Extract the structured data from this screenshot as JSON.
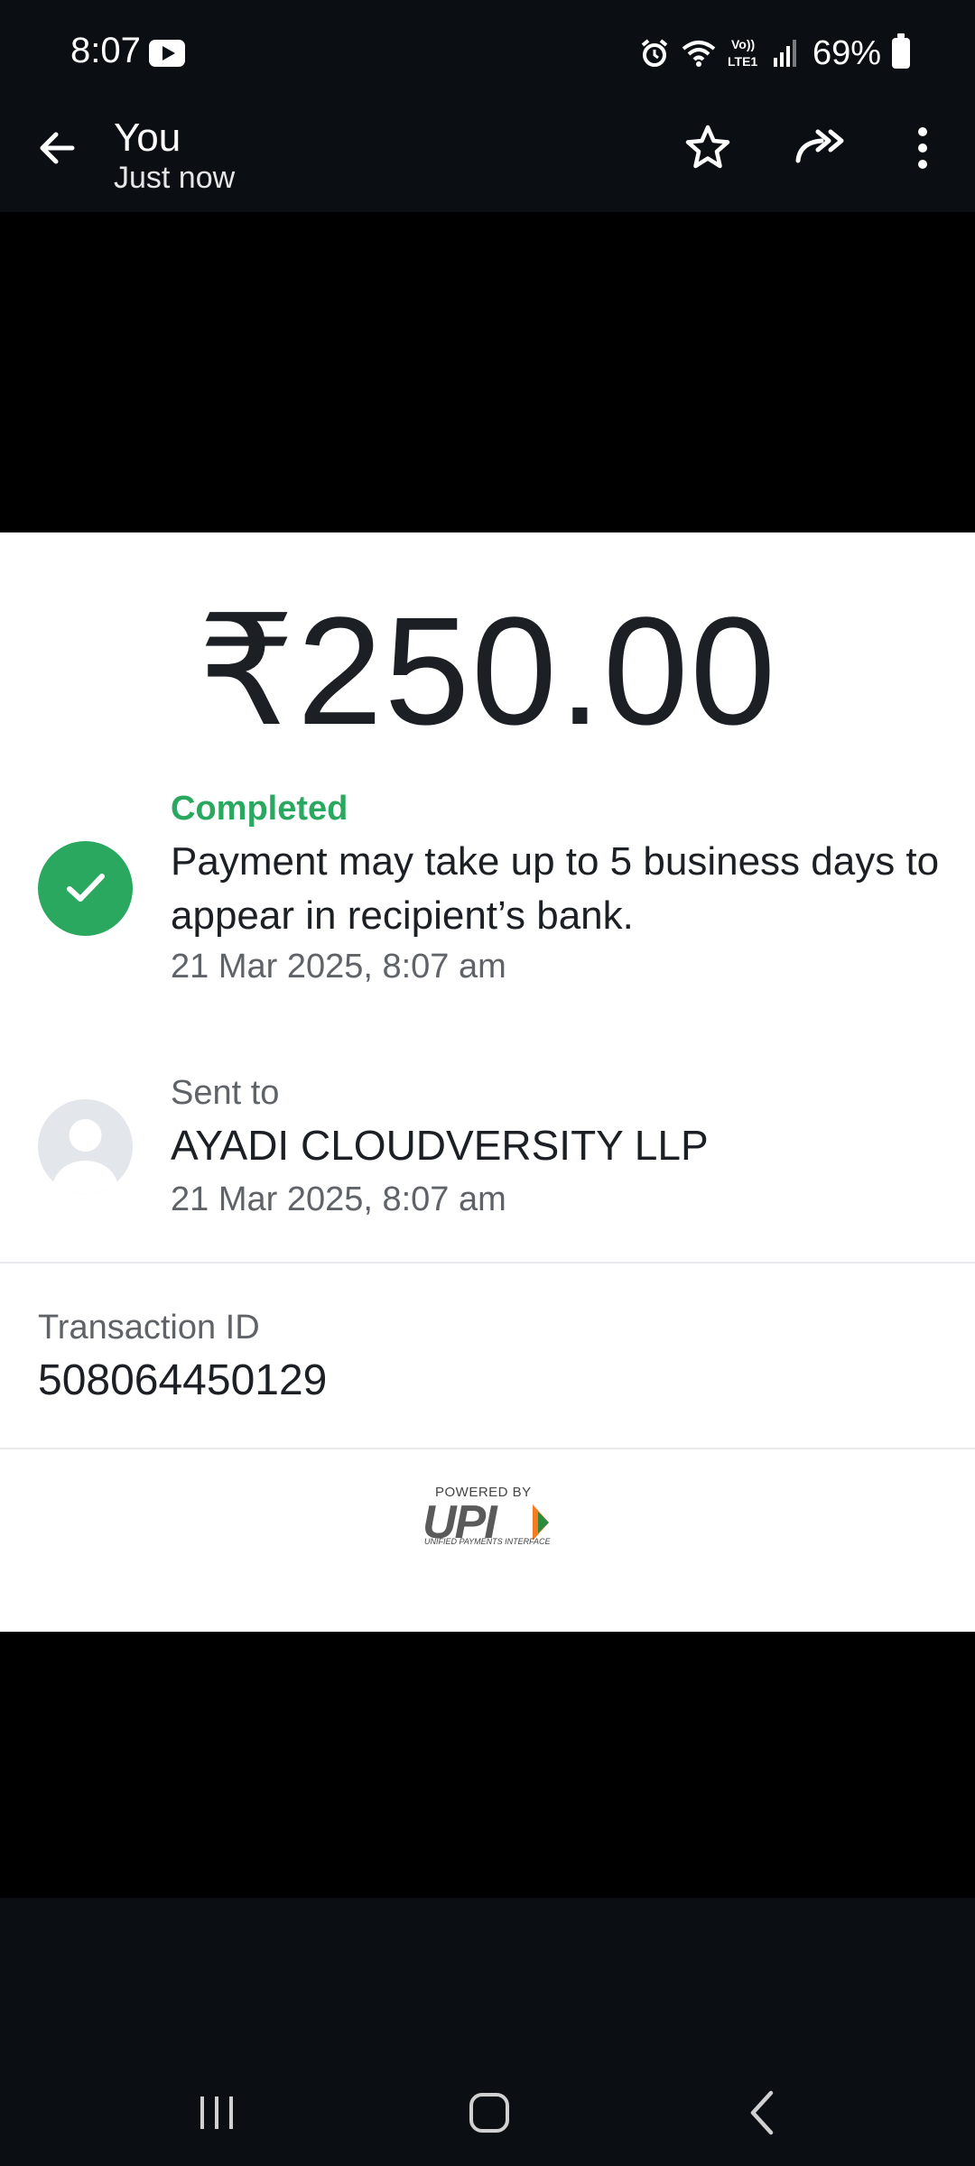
{
  "status_bar": {
    "time": "8:07",
    "lte_label": "LTE1",
    "battery": "69%"
  },
  "header": {
    "title": "You",
    "subtitle": "Just now",
    "icons": [
      "back-arrow-icon",
      "star-icon",
      "forward-icon",
      "more-vert-icon"
    ]
  },
  "payment": {
    "amount": "₹250.00",
    "status_label": "Completed",
    "status_message": "Payment may take up to 5 business days to appear in recipient’s bank.",
    "status_time": "21 Mar 2025, 8:07 am",
    "sent_to_label": "Sent to",
    "recipient": "AYADI CLOUDVERSITY LLP",
    "sent_time": "21 Mar 2025, 8:07 am",
    "transaction_label": "Transaction ID",
    "transaction_id": "508064450129",
    "accent_color": "#2aa860"
  },
  "footer_logo": {
    "powered_by": "POWERED BY",
    "brand": "UPI",
    "tagline": "UNIFIED PAYMENTS INTERFACE"
  },
  "nav_bar": {
    "icons": [
      "recents-icon",
      "home-icon",
      "back-icon"
    ]
  }
}
